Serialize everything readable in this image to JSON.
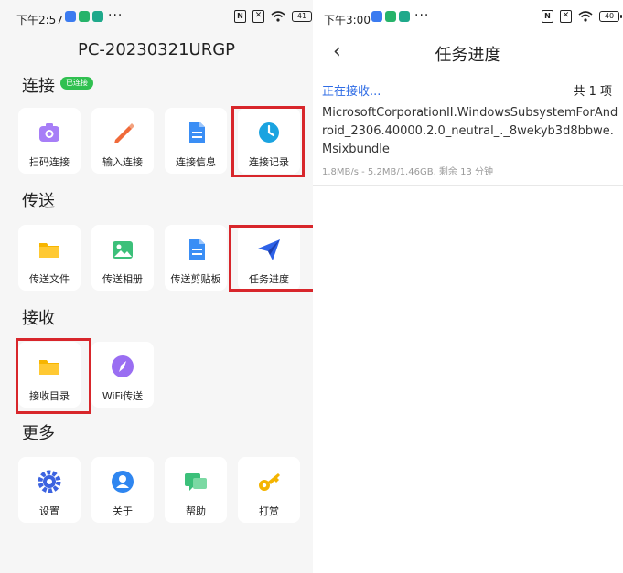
{
  "left": {
    "status": {
      "time": "下午2:57",
      "dots": "···",
      "battery": "41"
    },
    "device_title": "PC-20230321URGP",
    "sections": {
      "connect": {
        "title": "连接",
        "badge": "已连接"
      },
      "send": {
        "title": "传送"
      },
      "receive": {
        "title": "接收"
      },
      "more": {
        "title": "更多"
      }
    },
    "tiles": {
      "scan": "扫码连接",
      "input": "输入连接",
      "info": "连接信息",
      "record": "连接记录",
      "send_file": "传送文件",
      "send_album": "传送相册",
      "send_clip": "传送剪贴板",
      "task": "任务进度",
      "recv_dir": "接收目录",
      "wifi": "WiFi传送",
      "settings": "设置",
      "about": "关于",
      "help": "帮助",
      "reward": "打赏"
    }
  },
  "right": {
    "status": {
      "time": "下午3:00",
      "dots": "···",
      "battery": "40"
    },
    "back": "‹",
    "title": "任务进度",
    "receiving": "正在接收...",
    "total": "共 1 项",
    "file_name": "MicrosoftCorporationII.WindowsSubsystemForAndroid_2306.40000.2.0_neutral_._8wekyb3d8bbwe.Msixbundle",
    "progress": "1.8MB/s - 5.2MB/1.46GB, 剩余 13 分钟"
  },
  "colors": {
    "accent": "#2f6ce5",
    "highlight": "#d8262b",
    "badge": "#30c050"
  }
}
